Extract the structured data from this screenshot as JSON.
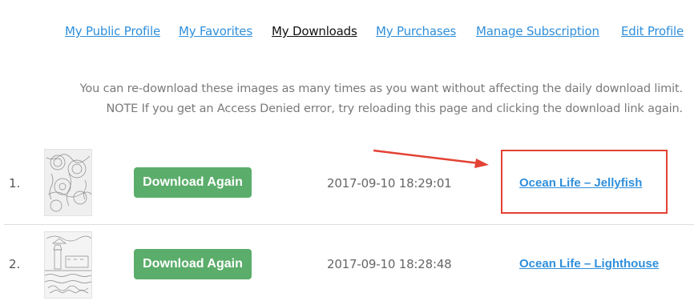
{
  "nav": {
    "items": [
      {
        "label": "My Public Profile"
      },
      {
        "label": "My Favorites"
      },
      {
        "label": "My Downloads"
      },
      {
        "label": "My Purchases"
      },
      {
        "label": "Manage Subscription"
      },
      {
        "label": "Edit Profile"
      }
    ],
    "active": "My Downloads"
  },
  "notice": {
    "line1": "You can re-download these images as many times as you want without affecting the daily download limit.",
    "line2": "NOTE If you get an Access Denied error, try reloading this page and clicking the download link again."
  },
  "downloads": [
    {
      "index": "1.",
      "button_label": "Download Again",
      "date": "2017-09-10 18:29:01",
      "title": "Ocean Life – Jellyfish"
    },
    {
      "index": "2.",
      "button_label": "Download Again",
      "date": "2017-09-10 18:28:48",
      "title": "Ocean Life – Lighthouse"
    }
  ],
  "colors": {
    "link": "#2f8fdb",
    "button": "#5aad6a",
    "annotation": "#e34234"
  }
}
